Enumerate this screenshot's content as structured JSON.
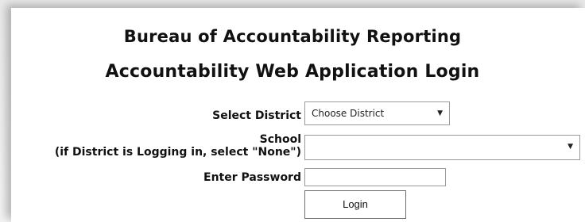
{
  "header": {
    "title_line1": "Bureau of Accountability Reporting",
    "title_line2": "Accountability Web Application Login"
  },
  "form": {
    "district_label": "Select District",
    "district_value": "Choose District",
    "school_label": "School",
    "school_sublabel": "(if District is Logging in, select \"None\")",
    "school_value": "",
    "password_label": "Enter Password",
    "password_value": "",
    "login_label": "Login",
    "dropdown_caret": "▼"
  }
}
